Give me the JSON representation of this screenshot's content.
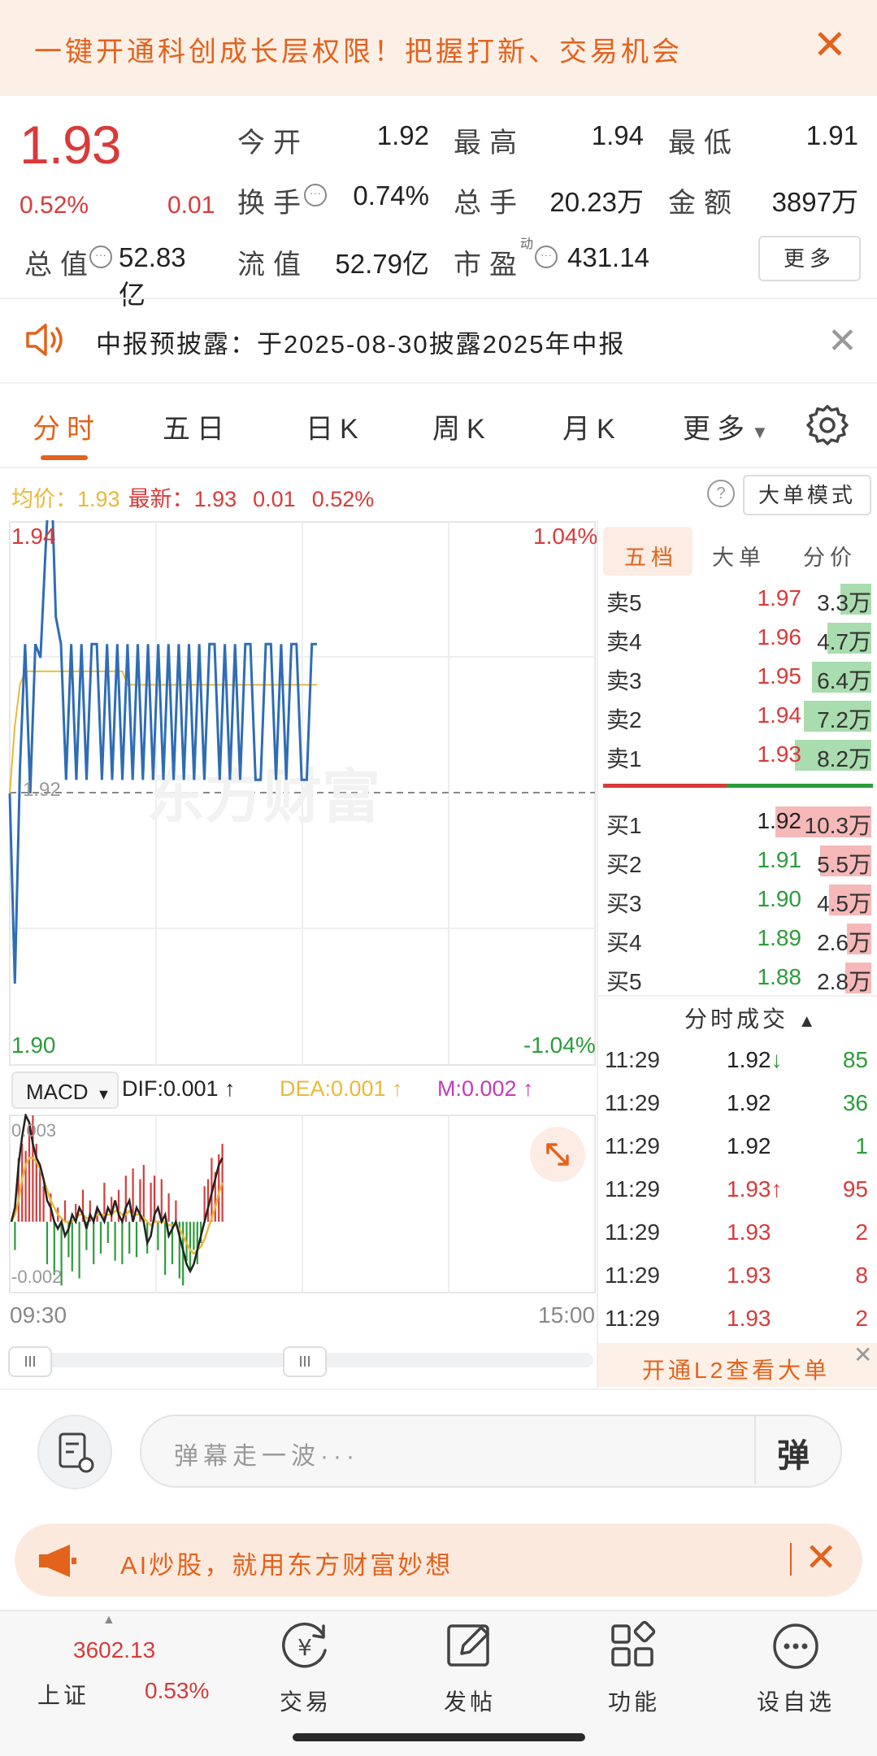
{
  "top_banner": {
    "text": "一键开通科创成长层权限！把握打新、交易机会"
  },
  "quote": {
    "price": "1.93",
    "change_pct": "0.52%",
    "change": "0.01",
    "open_label": "今开",
    "open": "1.92",
    "high_label": "最高",
    "high": "1.94",
    "low_label": "最低",
    "low": "1.91",
    "turnover_label": "换手",
    "turnover": "0.74%",
    "volume_label": "总手",
    "volume": "20.23万",
    "amount_label": "金额",
    "amount": "3897万",
    "mktcap_label": "总值",
    "mktcap": "52.83亿",
    "float_label": "流值",
    "float_cap": "52.79亿",
    "pe_label": "市盈",
    "pe_sup": "动",
    "pe": "431.14",
    "more_button": "更多"
  },
  "notice": {
    "text": "中报预披露：于2025-08-30披露2025年中报"
  },
  "tabs": [
    "分时",
    "五日",
    "日K",
    "周K",
    "月K",
    "更多"
  ],
  "info_bar": {
    "avg_label": "均价：",
    "avg": "1.93",
    "latest_label": "最新：",
    "latest": "1.93",
    "change": "0.01",
    "pct": "0.52%",
    "big_order_button": "大单模式"
  },
  "chart_data": {
    "type": "line",
    "y_price_top": "1.94",
    "y_price_bottom": "1.90",
    "y_pct_top": "1.04%",
    "y_pct_bottom": "-1.04%",
    "prev_close": 1.92,
    "ylim": [
      1.9,
      1.94
    ],
    "x_start": "09:30",
    "x_end": "15:00",
    "ref_label": "1.92",
    "series": [
      {
        "values": [
          1.92,
          1.906,
          1.922,
          1.931,
          1.92,
          1.931,
          1.93,
          1.938,
          1.945,
          1.933,
          1.931,
          1.921,
          1.931,
          1.921,
          1.931,
          1.921,
          1.931,
          1.931,
          1.921,
          1.931,
          1.921,
          1.931,
          1.921,
          1.931,
          1.921,
          1.931,
          1.921,
          1.931,
          1.921,
          1.931,
          1.921,
          1.931,
          1.921,
          1.931,
          1.921,
          1.931,
          1.921,
          1.931,
          1.921,
          1.931,
          1.931,
          1.921,
          1.931,
          1.921,
          1.931,
          1.921,
          1.931,
          1.931,
          1.921,
          1.921,
          1.931,
          1.931,
          1.921,
          1.931,
          1.921,
          1.931,
          1.931,
          1.921,
          1.921,
          1.931,
          1.931
        ]
      },
      {
        "values": [
          1.92,
          1.925,
          1.928,
          1.929,
          1.929,
          1.929,
          1.929,
          1.929,
          1.929,
          1.929,
          1.929,
          1.929,
          1.929,
          1.929,
          1.929,
          1.929,
          1.929,
          1.929,
          1.929,
          1.929,
          1.929,
          1.929,
          1.929,
          1.928,
          1.928,
          1.928,
          1.928,
          1.928,
          1.928,
          1.928,
          1.928,
          1.928,
          1.928,
          1.928,
          1.928,
          1.928,
          1.928,
          1.928,
          1.928,
          1.928,
          1.928,
          1.928,
          1.928,
          1.928,
          1.928,
          1.928,
          1.928,
          1.928,
          1.928,
          1.928,
          1.928,
          1.928,
          1.928,
          1.928,
          1.928,
          1.928,
          1.928,
          1.928,
          1.928,
          1.928,
          1.928
        ]
      }
    ]
  },
  "macd": {
    "select": "MACD",
    "dif": "DIF:0.001",
    "dea": "DEA:0.001",
    "m": "M:0.002",
    "y_top": "0.003",
    "y_bottom": "-0.002",
    "ylim": [
      -0.002,
      0.003
    ],
    "bars": [
      0.0,
      -0.0008,
      0.0018,
      0.0022,
      0.002,
      0.0028,
      0.003,
      0.0022,
      0.0015,
      0.001,
      -0.0012,
      0.0008,
      -0.0015,
      0.0004,
      -0.0018,
      0.0006,
      -0.001,
      -0.0014,
      0.0005,
      -0.0016,
      0.0009,
      -0.0008,
      0.0006,
      -0.0012,
      0.0004,
      -0.0009,
      0.0011,
      -0.0006,
      0.0007,
      -0.0011,
      0.0009,
      -0.0012,
      0.0013,
      -0.0009,
      0.0015,
      -0.001,
      0.0012,
      0.0016,
      -0.0009,
      0.0011,
      0.0013,
      -0.0008,
      0.0012,
      -0.0015,
      0.0008,
      -0.0012,
      0.0006,
      -0.0016,
      -0.0018,
      -0.0011,
      -0.0014,
      -0.0008,
      -0.0012,
      -0.0006,
      0.001,
      0.0012,
      0.0018,
      0.0014,
      0.0019,
      0.0022
    ],
    "dif_values": [
      0.0,
      0.0004,
      0.0016,
      0.0024,
      0.003,
      0.0028,
      0.0022,
      0.0018,
      0.0016,
      0.0012,
      0.0006,
      0.0004,
      0.0,
      -0.0002,
      0.0,
      -0.0004,
      -0.0002,
      0.0002,
      0.0,
      0.0004,
      0.0002,
      -0.0002,
      0.0002,
      0.0,
      0.0004,
      0.0002,
      0.0,
      0.0004,
      0.0002,
      0.0006,
      0.0002,
      0.0,
      0.0004,
      0.0006,
      0.0,
      0.0004,
      0.0002,
      0.0,
      -0.0006,
      -0.0004,
      0.0002,
      0.0004,
      0.0,
      0.0002,
      -0.0004,
      -0.0002,
      0.0,
      -0.0004,
      -0.0008,
      -0.0012,
      -0.0014,
      -0.0012,
      -0.0008,
      -0.0004,
      0.0,
      0.0004,
      0.0008,
      0.0012,
      0.0016,
      0.0018
    ],
    "dea_values": [
      0.0,
      0.0002,
      0.0006,
      0.0012,
      0.0016,
      0.0018,
      0.0018,
      0.0017,
      0.0015,
      0.0012,
      0.0009,
      0.0006,
      0.0004,
      0.0002,
      0.0001,
      0.0,
      0.0,
      0.0,
      0.0001,
      0.0002,
      0.0002,
      0.0001,
      0.0001,
      0.0001,
      0.0002,
      0.0002,
      0.0002,
      0.0002,
      0.0002,
      0.0003,
      0.0003,
      0.0002,
      0.0002,
      0.0003,
      0.0002,
      0.0002,
      0.0002,
      0.0001,
      0.0,
      -0.0001,
      0.0,
      0.0,
      0.0,
      0.0,
      -0.0001,
      -0.0001,
      -0.0001,
      -0.0002,
      -0.0004,
      -0.0006,
      -0.0008,
      -0.0009,
      -0.0008,
      -0.0007,
      -0.0005,
      -0.0002,
      0.0001,
      0.0004,
      0.0008,
      0.0011
    ],
    "x_start": "09:30",
    "x_end": "15:00"
  },
  "order_book": {
    "tabs": [
      "五档",
      "大单",
      "分价"
    ],
    "asks": [
      {
        "label": "卖5",
        "price": "1.97",
        "vol": "3.3万",
        "ratio": 0.32
      },
      {
        "label": "卖4",
        "price": "1.96",
        "vol": "4.7万",
        "ratio": 0.46
      },
      {
        "label": "卖3",
        "price": "1.95",
        "vol": "6.4万",
        "ratio": 0.62
      },
      {
        "label": "卖2",
        "price": "1.94",
        "vol": "7.2万",
        "ratio": 0.7
      },
      {
        "label": "卖1",
        "price": "1.93",
        "vol": "8.2万",
        "ratio": 0.8
      }
    ],
    "bids": [
      {
        "label": "买1",
        "price": "1.92",
        "vol": "10.3万",
        "ratio": 1.0
      },
      {
        "label": "买2",
        "price": "1.91",
        "vol": "5.5万",
        "ratio": 0.53
      },
      {
        "label": "买3",
        "price": "1.90",
        "vol": "4.5万",
        "ratio": 0.44
      },
      {
        "label": "买4",
        "price": "1.89",
        "vol": "2.6万",
        "ratio": 0.25
      },
      {
        "label": "买5",
        "price": "1.88",
        "vol": "2.8万",
        "ratio": 0.27
      }
    ]
  },
  "ticks": {
    "header": "分时成交",
    "rows": [
      {
        "time": "11:29",
        "price": "1.92",
        "arrow": "↓",
        "vol": "85",
        "pcolor": "black",
        "vcolor": "green"
      },
      {
        "time": "11:29",
        "price": "1.92",
        "arrow": "",
        "vol": "36",
        "pcolor": "black",
        "vcolor": "green"
      },
      {
        "time": "11:29",
        "price": "1.92",
        "arrow": "",
        "vol": "1",
        "pcolor": "black",
        "vcolor": "green"
      },
      {
        "time": "11:29",
        "price": "1.93",
        "arrow": "↑",
        "vol": "95",
        "pcolor": "red",
        "vcolor": "red"
      },
      {
        "time": "11:29",
        "price": "1.93",
        "arrow": "",
        "vol": "2",
        "pcolor": "red",
        "vcolor": "red"
      },
      {
        "time": "11:29",
        "price": "1.93",
        "arrow": "",
        "vol": "8",
        "pcolor": "red",
        "vcolor": "red"
      },
      {
        "time": "11:29",
        "price": "1.93",
        "arrow": "",
        "vol": "2",
        "pcolor": "red",
        "vcolor": "red"
      }
    ],
    "l2_link": "开通L2查看大单"
  },
  "comment": {
    "placeholder": "弹幕走一波···",
    "danmu": "弹"
  },
  "ai_banner": {
    "text": "AI炒股，就用东方财富妙想"
  },
  "bottom_nav": {
    "index_value": "3602.13",
    "index_name": "上证",
    "index_pct": "0.53%",
    "items": [
      "交易",
      "发帖",
      "功能",
      "设自选"
    ]
  },
  "colors": {
    "accent": "#e3621c",
    "up": "#d93a3a",
    "down": "#2c9c3a",
    "price_line": "#2f6db5",
    "avg_line": "#e8b93a"
  }
}
